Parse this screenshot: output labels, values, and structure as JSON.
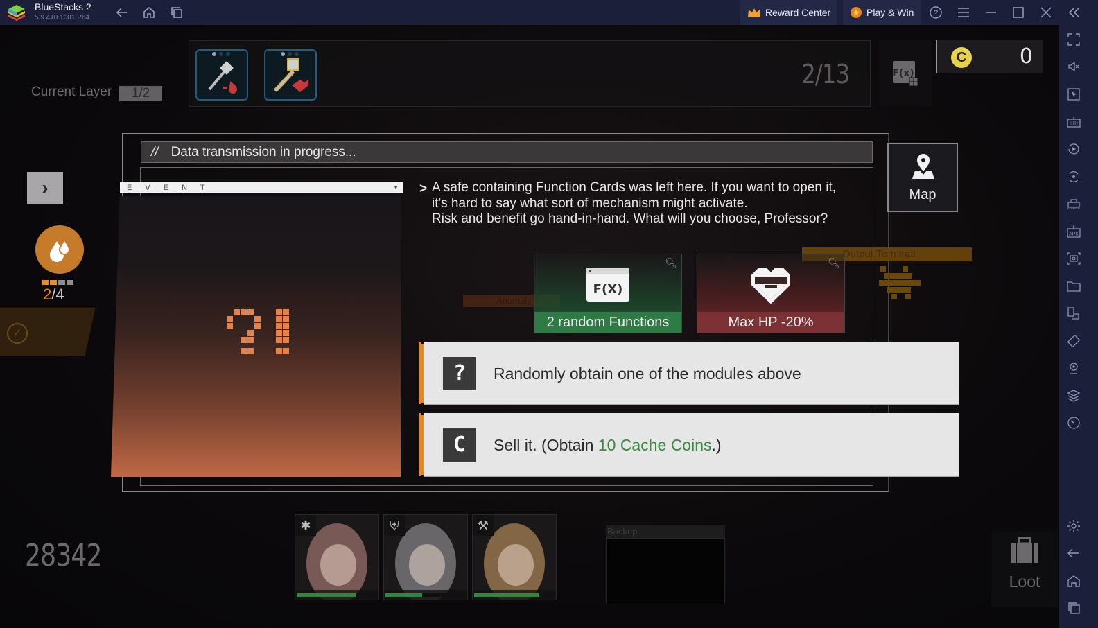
{
  "titlebar": {
    "app_name": "BlueStacks 2",
    "version": "5.9.410.1001  P64",
    "nav_icons": [
      "back-icon",
      "home-icon",
      "recent-apps-icon"
    ],
    "reward_center_label": "Reward Center",
    "play_win_label": "Play & Win",
    "window_icons": [
      "help-icon",
      "menu-icon",
      "minimize-icon",
      "maximize-icon",
      "close-icon",
      "collapse-sidebar-icon"
    ]
  },
  "sidebar": {
    "top_icons": [
      "fullscreen-icon",
      "volume-icon",
      "pointer-icon",
      "keyboard-icon",
      "macro-record-icon",
      "sync-icon",
      "install-game-icon",
      "apk-icon",
      "screenshot-icon",
      "folder-icon",
      "multi-instance-icon",
      "rotate-icon",
      "location-icon",
      "layers-icon",
      "performance-icon"
    ],
    "bottom_icons": [
      "settings-icon",
      "back-icon",
      "home-icon",
      "recent-apps-icon"
    ]
  },
  "hud": {
    "current_layer_label": "Current Layer",
    "current_layer_value": "1/2",
    "floor_count": "2/13",
    "fx_button_label": "F(x)",
    "coins": "0",
    "skill_charges_current": "2",
    "skill_charges_total": "4",
    "skill_charges_filled": 2,
    "score": "28342",
    "backup_label": "Backup",
    "loot_label": "Loot",
    "map_label": "Map"
  },
  "relics": [
    {
      "name": "axe-blood-relic"
    },
    {
      "name": "sword-heart-relic"
    }
  ],
  "map_bg": {
    "output_terminal": "Output Terminal",
    "anomaly_area": "Anomaly Area"
  },
  "event": {
    "header": "Data transmission in progress...",
    "header_prefix": "//",
    "event_tag": "E V E N T",
    "description_lines": [
      "A safe containing Function Cards was left here. If you want to open it,",
      "it's hard to say what sort of mechanism might activate.",
      "Risk and benefit go hand-in-hand. What will you choose, Professor?"
    ],
    "rewards": [
      {
        "label": "2 random Functions",
        "icon": "function-card-icon",
        "color": "#2f7b46"
      },
      {
        "label": "Max HP -20%",
        "icon": "heart-minus-icon",
        "color": "#7c3134"
      }
    ],
    "choices": [
      {
        "icon": "?",
        "text": "Randomly obtain one of the modules above",
        "highlight": ""
      },
      {
        "icon": "C",
        "text_before": "Sell it. (Obtain ",
        "highlight": "10 Cache Coins",
        "text_after": ".)"
      }
    ]
  },
  "operators": [
    {
      "class_icon": "✱",
      "hp": 0.72,
      "hair": "#c98f86"
    },
    {
      "class_icon": "⛨",
      "hp": 0.45,
      "hair": "#a9a7ab"
    },
    {
      "class_icon": "⚒",
      "hp": 0.8,
      "hair": "#d9a86a"
    }
  ],
  "colors": {
    "accent_orange": "#e28a22",
    "coin_yellow": "#e8d24c",
    "positive_green": "#3a8a3e"
  }
}
